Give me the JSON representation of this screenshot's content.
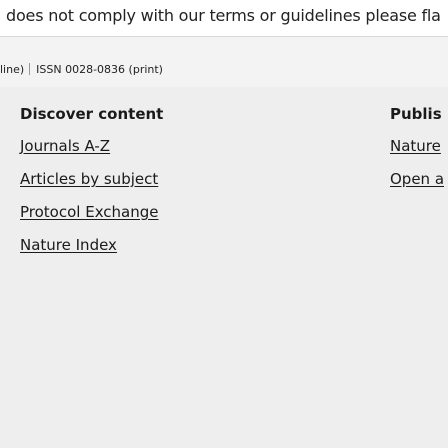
{
  "notice": {
    "text": "does not comply with our terms or guidelines please fla"
  },
  "issn": {
    "left": "line)",
    "value": "ISSN 0028-0836 (print)"
  },
  "footer": {
    "col1": {
      "title": "Discover content",
      "links": [
        "Journals A-Z",
        "Articles by subject",
        "Protocol Exchange",
        "Nature Index"
      ]
    },
    "col2": {
      "title": "Publis",
      "links": [
        "Nature",
        "Open a"
      ]
    }
  }
}
